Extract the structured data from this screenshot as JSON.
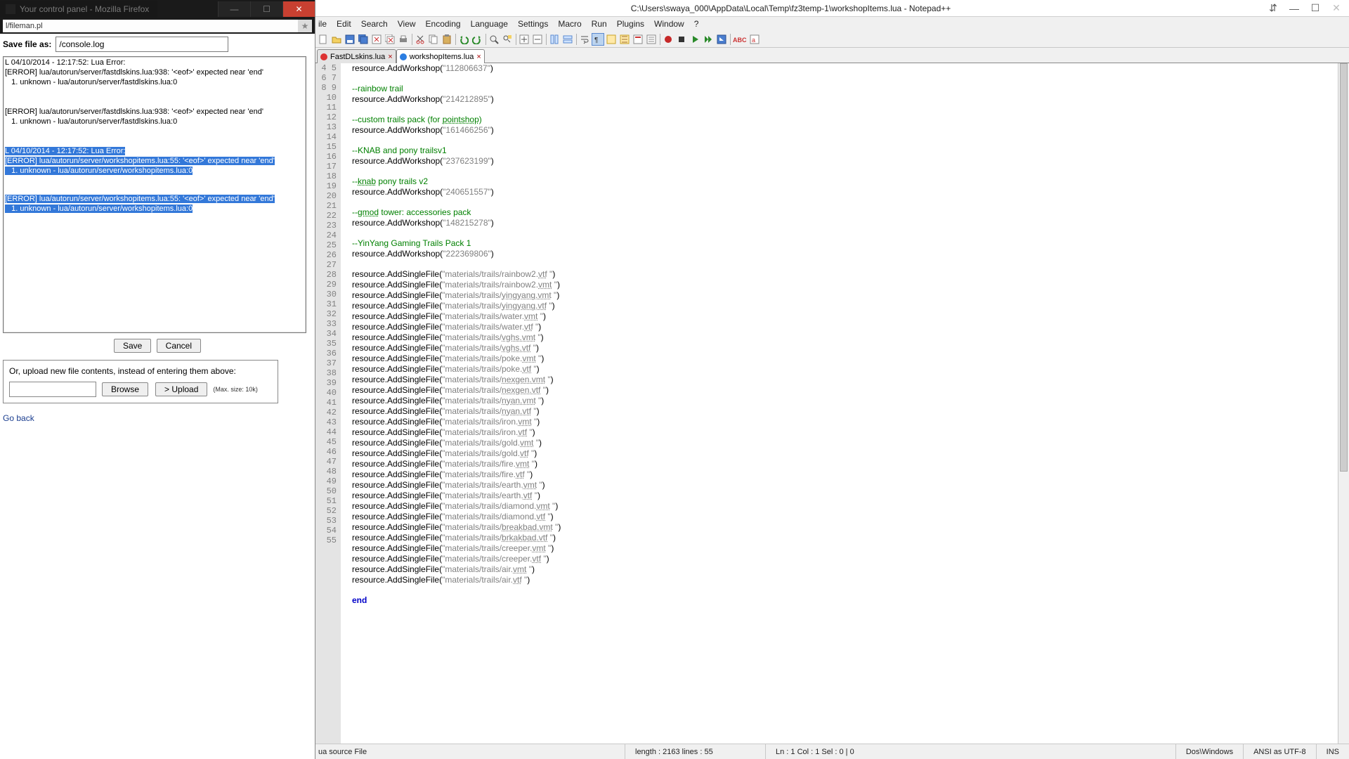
{
  "firefox": {
    "tab_title": "Your control panel - Mozilla Firefox",
    "address": "l/fileman.pl",
    "save_label": "Save file as:",
    "save_value": "/console.log",
    "buttons": {
      "save": "Save",
      "cancel": "Cancel",
      "browse": "Browse",
      "upload": "> Upload"
    },
    "upload_label": "Or, upload new file contents, instead of entering them above:",
    "upload_hint": "(Max. size: 10k)",
    "goback": "Go back",
    "log_plain_1": "L 04/10/2014 - 12:17:52: Lua Error:\n[ERROR] lua/autorun/server/fastdlskins.lua:938: '<eof>' expected near 'end'\n   1. unknown - lua/autorun/server/fastdlskins.lua:0\n\n\n[ERROR] lua/autorun/server/fastdlskins.lua:938: '<eof>' expected near 'end'\n   1. unknown - lua/autorun/server/fastdlskins.lua:0\n\n\n",
    "log_sel_1": "L 04/10/2014 - 12:17:52: Lua Error:",
    "log_sel_2": "[ERROR] lua/autorun/server/workshopitems.lua:55: '<eof>' expected near 'end'",
    "log_sel_3": "   1. unknown - lua/autorun/server/workshopitems.lua:0",
    "log_sel_4": "[ERROR] lua/autorun/server/workshopitems.lua:55: '<eof>' expected near 'end'",
    "log_sel_5": "   1. unknown - lua/autorun/server/workshopitems.lua:0"
  },
  "npp": {
    "title": "C:\\Users\\swaya_000\\AppData\\Local\\Temp\\fz3temp-1\\workshopItems.lua - Notepad++",
    "menu": [
      "ile",
      "Edit",
      "Search",
      "View",
      "Encoding",
      "Language",
      "Settings",
      "Macro",
      "Run",
      "Plugins",
      "Window",
      "?"
    ],
    "tabs": [
      {
        "label": "FastDLskins.lua",
        "dirty": true
      },
      {
        "label": "workshopItems.lua",
        "dirty": false,
        "active": true
      }
    ],
    "first_line": 4,
    "code": {
      "l4": {
        "pre": "resource.AddWorkshop(",
        "str": "\"112806637\"",
        "post": ")"
      },
      "l6": {
        "cm": "--rainbow trail"
      },
      "l7": {
        "pre": "resource.AddWorkshop(",
        "str": "\"214212895\"",
        "post": ")"
      },
      "l9a": "--custom trails pack (for ",
      "l9b": "pointshop",
      "l9c": ")",
      "l10": {
        "pre": "resource.AddWorkshop(",
        "str": "\"161466256\"",
        "post": ")"
      },
      "l12": {
        "cm": "--KNAB and pony trailsv1"
      },
      "l13": {
        "pre": "resource.AddWorkshop(",
        "str": "\"237623199\"",
        "post": ")"
      },
      "l15a": "--",
      "l15b": "knab",
      "l15c": " pony trails v2",
      "l16": {
        "pre": "resource.AddWorkshop(",
        "str": "\"240651557\"",
        "post": ")"
      },
      "l18a": "--",
      "l18b": "gmod",
      "l18c": " tower: accessories pack",
      "l19": {
        "pre": "resource.AddWorkshop(",
        "str": "\"148215278\"",
        "post": ")"
      },
      "l21": {
        "cm": "--YinYang Gaming Trails Pack 1"
      },
      "l22": {
        "pre": "resource.AddWorkshop(",
        "str": "\"222369806\"",
        "post": ")"
      },
      "files": [
        {
          "p": "\"materials/trails/rainbow2.",
          "u": "vtf",
          "s": " \""
        },
        {
          "p": "\"materials/trails/rainbow2.",
          "u": "vmt",
          "s": " \""
        },
        {
          "p": "\"materials/trails/",
          "u": "yingyang.vmt",
          "s": " \""
        },
        {
          "p": "\"materials/trails/",
          "u": "yingyang.vtf",
          "s": " \""
        },
        {
          "p": "\"materials/trails/water.",
          "u": "vmt",
          "s": " \""
        },
        {
          "p": "\"materials/trails/water.",
          "u": "vtf",
          "s": " \""
        },
        {
          "p": "\"materials/trails/",
          "u": "vghs.vmt",
          "s": " \""
        },
        {
          "p": "\"materials/trails/",
          "u": "vghs.vtf",
          "s": " \""
        },
        {
          "p": "\"materials/trails/poke.",
          "u": "vmt",
          "s": " \""
        },
        {
          "p": "\"materials/trails/poke.",
          "u": "vtf",
          "s": " \""
        },
        {
          "p": "\"materials/trails/",
          "u": "nexgen.vmt",
          "s": " \""
        },
        {
          "p": "\"materials/trails/",
          "u": "nexgen.vtf",
          "s": " \""
        },
        {
          "p": "\"materials/trails/",
          "u": "nyan.vmt",
          "s": " \""
        },
        {
          "p": "\"materials/trails/",
          "u": "nyan.vtf",
          "s": " \""
        },
        {
          "p": "\"materials/trails/iron.",
          "u": "vmt",
          "s": " \""
        },
        {
          "p": "\"materials/trails/iron.",
          "u": "vtf",
          "s": " \""
        },
        {
          "p": "\"materials/trails/gold.",
          "u": "vmt",
          "s": " \""
        },
        {
          "p": "\"materials/trails/gold.",
          "u": "vtf",
          "s": " \""
        },
        {
          "p": "\"materials/trails/fire.",
          "u": "vmt",
          "s": " \""
        },
        {
          "p": "\"materials/trails/fire.",
          "u": "vtf",
          "s": " \""
        },
        {
          "p": "\"materials/trails/earth.",
          "u": "vmt",
          "s": " \""
        },
        {
          "p": "\"materials/trails/earth.",
          "u": "vtf",
          "s": " \""
        },
        {
          "p": "\"materials/trails/diamond.",
          "u": "vmt",
          "s": " \""
        },
        {
          "p": "\"materials/trails/diamond.",
          "u": "vtf",
          "s": " \""
        },
        {
          "p": "\"materials/trails/",
          "u": "breakbad.vmt",
          "s": " \""
        },
        {
          "p": "\"materials/trails/",
          "u": "brkakbad.vtf",
          "s": " \""
        },
        {
          "p": "\"materials/trails/creeper.",
          "u": "vmt",
          "s": " \""
        },
        {
          "p": "\"materials/trails/creeper.",
          "u": "vtf",
          "s": " \""
        },
        {
          "p": "\"materials/trails/air.",
          "u": "vmt",
          "s": " \""
        },
        {
          "p": "\"materials/trails/air.",
          "u": "vtf",
          "s": " \""
        }
      ],
      "end": "end"
    },
    "status": {
      "filetype": "ua source File",
      "length": "length : 2163    lines : 55",
      "pos": "Ln : 1    Col : 1    Sel : 0 | 0",
      "eol": "Dos\\Windows",
      "enc": "ANSI as UTF-8",
      "ins": "INS"
    }
  }
}
